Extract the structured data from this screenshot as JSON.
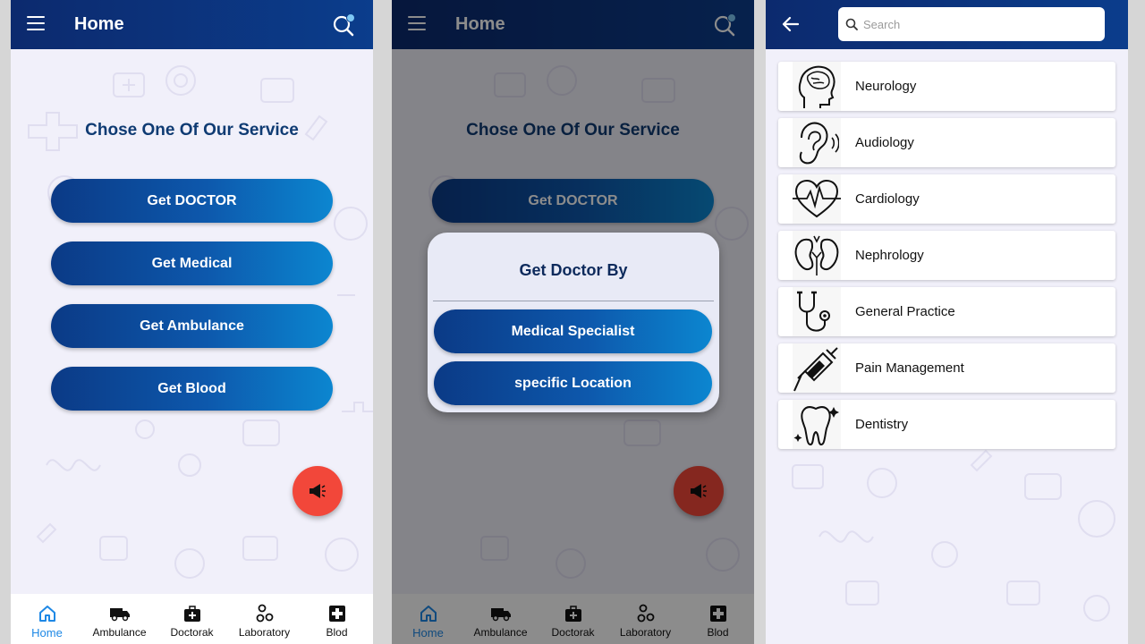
{
  "screen1": {
    "appbar": {
      "title": "Home"
    },
    "section_title": "Chose One Of Our Service",
    "services": [
      {
        "label": "Get DOCTOR"
      },
      {
        "label": "Get Medical"
      },
      {
        "label": "Get Ambulance"
      },
      {
        "label": "Get Blood"
      }
    ]
  },
  "screen2": {
    "appbar": {
      "title": "Home"
    },
    "section_title": "Chose One Of Our Service",
    "service_visible": "Get DOCTOR",
    "dialog": {
      "title": "Get Doctor By",
      "options": [
        {
          "label": "Medical Specialist"
        },
        {
          "label": "specific Location"
        }
      ]
    }
  },
  "bottom_nav": [
    {
      "label": "Home",
      "icon": "home-icon",
      "active": true
    },
    {
      "label": "Ambulance",
      "icon": "ambulance-icon"
    },
    {
      "label": "Doctorak",
      "icon": "medical-bag-icon"
    },
    {
      "label": "Laboratory",
      "icon": "laboratory-icon"
    },
    {
      "label": "Blod",
      "icon": "blood-cross-icon"
    }
  ],
  "screen3": {
    "search": {
      "placeholder": "Search",
      "value": ""
    },
    "specialties": [
      {
        "label": "Neurology",
        "icon": "brain-head-icon"
      },
      {
        "label": "Audiology",
        "icon": "ear-icon"
      },
      {
        "label": "Cardiology",
        "icon": "heart-pulse-icon"
      },
      {
        "label": "Nephrology",
        "icon": "kidneys-icon"
      },
      {
        "label": "General Practice",
        "icon": "stethoscope-icon"
      },
      {
        "label": "Pain Management",
        "icon": "syringe-icon"
      },
      {
        "label": "Dentistry",
        "icon": "tooth-icon"
      }
    ]
  },
  "colors": {
    "appbar": "#0c2a6e",
    "accent": "#1e88e5",
    "fab": "#f2473a",
    "title_text": "#0f3b73"
  }
}
